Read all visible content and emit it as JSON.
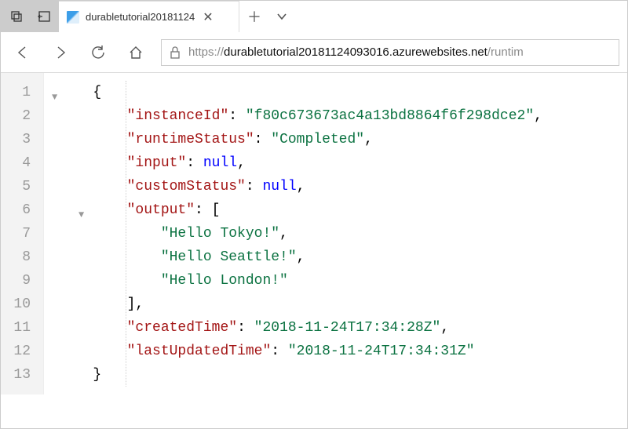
{
  "tab": {
    "title": "durabletutorial20181124"
  },
  "url": {
    "proto": "https://",
    "host": "durabletutorial20181124093016.azurewebsites.net",
    "path": "/runtim"
  },
  "json": {
    "instanceId_key": "\"instanceId\"",
    "instanceId_val": "\"f80c673673ac4a13bd8864f6f298dce2\"",
    "runtimeStatus_key": "\"runtimeStatus\"",
    "runtimeStatus_val": "\"Completed\"",
    "input_key": "\"input\"",
    "null": "null",
    "customStatus_key": "\"customStatus\"",
    "output_key": "\"output\"",
    "out0": "\"Hello Tokyo!\"",
    "out1": "\"Hello Seattle!\"",
    "out2": "\"Hello London!\"",
    "createdTime_key": "\"createdTime\"",
    "createdTime_val": "\"2018-11-24T17:34:28Z\"",
    "lastUpdatedTime_key": "\"lastUpdatedTime\"",
    "lastUpdatedTime_val": "\"2018-11-24T17:34:31Z\""
  },
  "lines": [
    "1",
    "2",
    "3",
    "4",
    "5",
    "6",
    "7",
    "8",
    "9",
    "10",
    "11",
    "12",
    "13"
  ]
}
